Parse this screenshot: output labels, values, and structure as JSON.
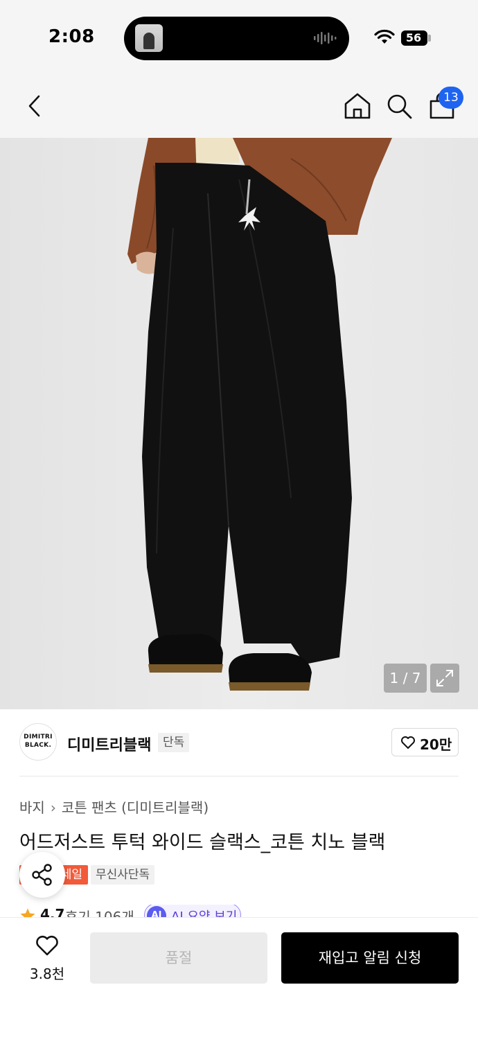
{
  "status": {
    "time": "2:08",
    "battery": "56"
  },
  "nav": {
    "back_icon": "chevron-left-icon",
    "home_icon": "home-icon",
    "search_icon": "search-icon",
    "cart_icon": "shopping-bag-icon",
    "cart_badge": "13"
  },
  "gallery": {
    "counter": "1 / 7",
    "expand_icon": "expand-icon"
  },
  "brand": {
    "logo_line1": "DIMITRI",
    "logo_line2": "BLACK.",
    "name": "디미트리블랙",
    "tag": "단독",
    "like_count": "20만"
  },
  "product": {
    "breadcrumb": [
      "바지",
      "코튼 팬츠 (디미트리블랙)"
    ],
    "title": "어드저스트 투턱 와이드 슬랙스_코튼 치노 블랙",
    "sale_tag": "세일",
    "exclusive_tag": "무신사단독",
    "rating": "4.7",
    "reviews": "후기 106개",
    "ai_badge": "AI",
    "ai_summary": "AI 요약 보기"
  },
  "bottom": {
    "wish_count": "3.8천",
    "soldout_label": "품절",
    "restock_label": "재입고 알림 신청"
  },
  "colors": {
    "accent_blue": "#1e64f0",
    "sale_red": "#f15a3a",
    "ai_purple": "#5b5cf0",
    "primary_button": "#000000"
  }
}
